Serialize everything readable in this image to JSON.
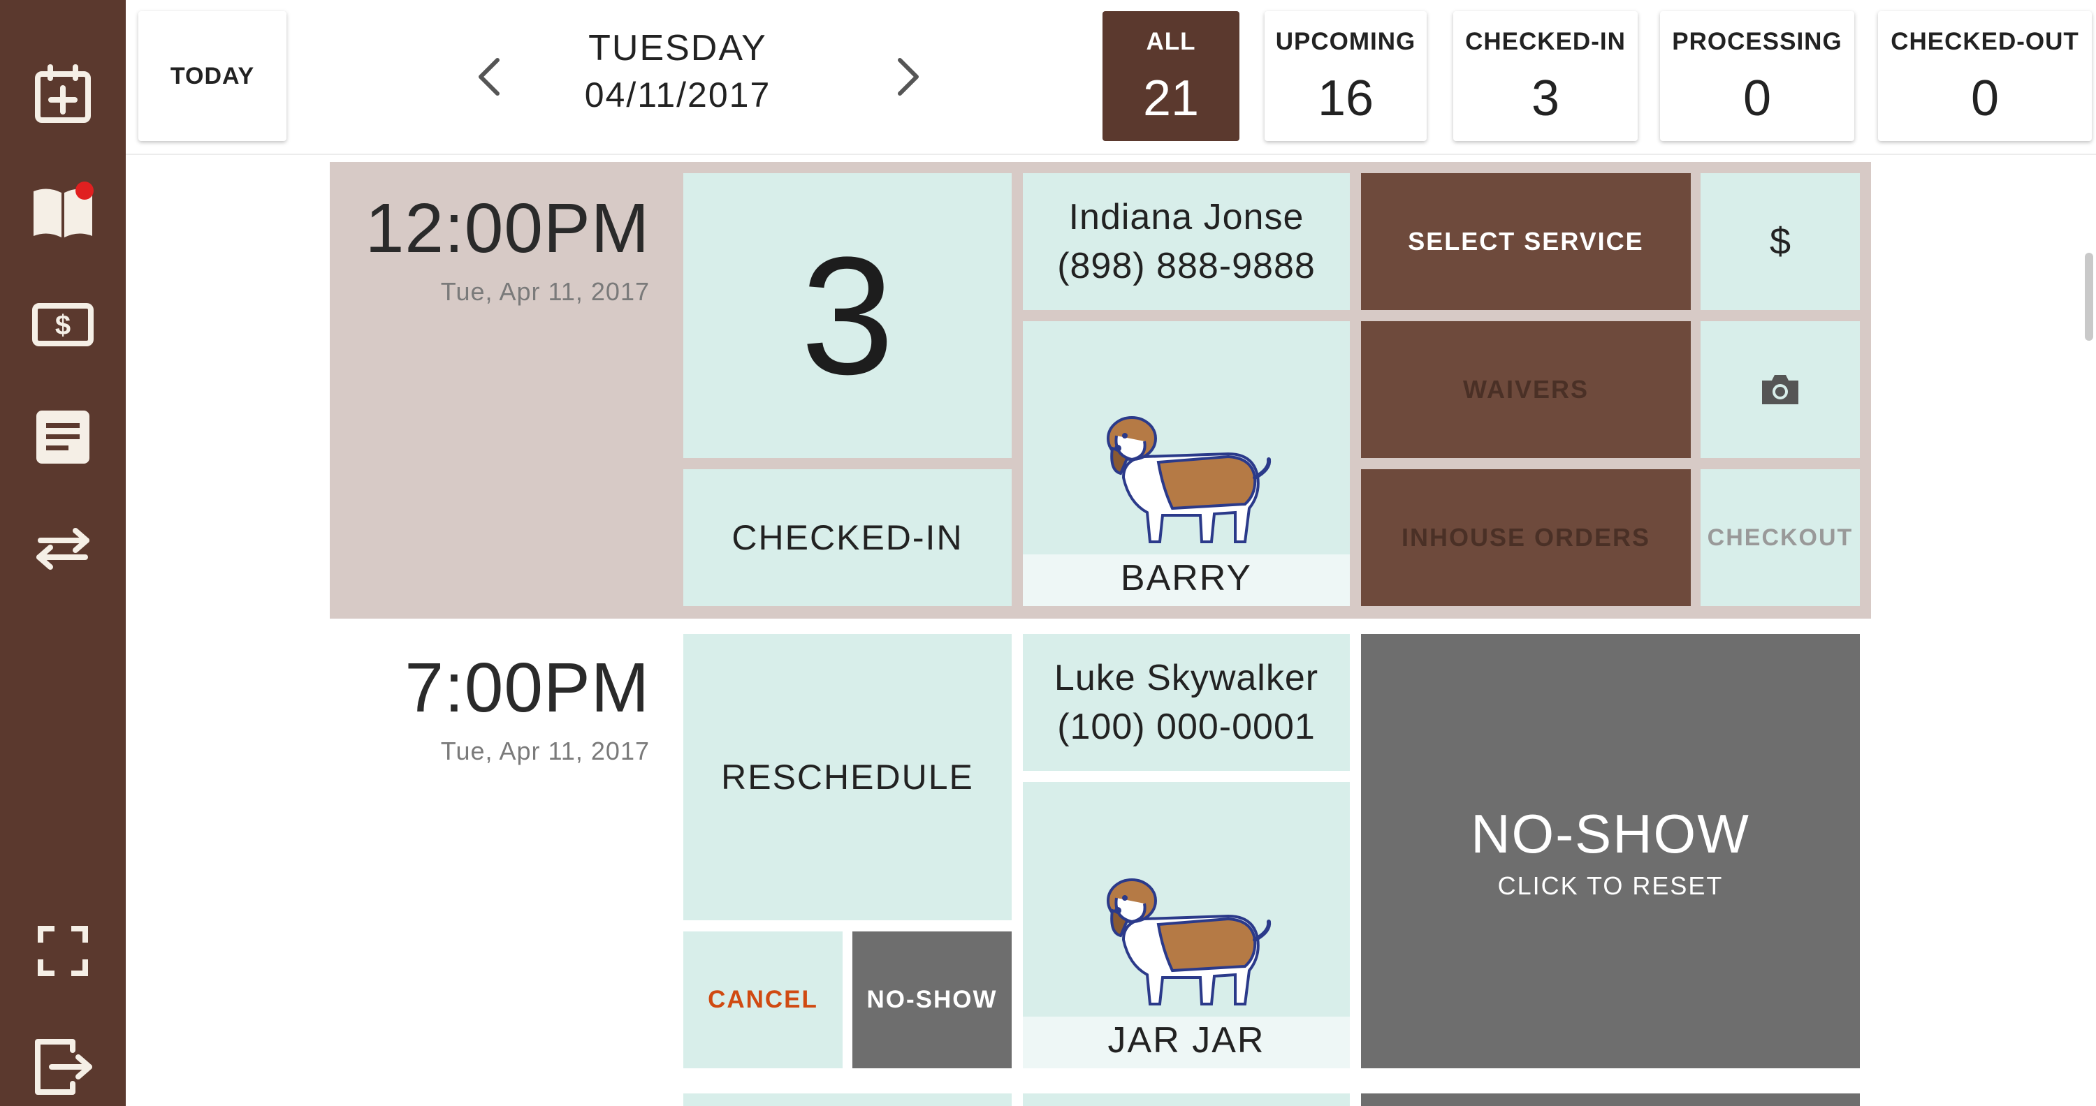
{
  "sidebar": {
    "items": [
      {
        "icon": "calendar-add-icon"
      },
      {
        "icon": "book-icon",
        "notification": true
      },
      {
        "icon": "dollar-bill-icon"
      },
      {
        "icon": "document-icon"
      },
      {
        "icon": "swap-arrows-icon"
      },
      {
        "icon": "fullscreen-icon"
      },
      {
        "icon": "logout-icon"
      }
    ]
  },
  "header": {
    "today_label": "TODAY",
    "day": "TUESDAY",
    "date": "04/11/2017",
    "filters": [
      {
        "label": "ALL",
        "count": "21",
        "active": true
      },
      {
        "label": "UPCOMING",
        "count": "16"
      },
      {
        "label": "CHECKED-IN",
        "count": "3"
      },
      {
        "label": "PROCESSING",
        "count": "0"
      },
      {
        "label": "CHECKED-OUT",
        "count": "0"
      }
    ]
  },
  "appointments": [
    {
      "time": "12:00PM",
      "date": "Tue, Apr 11, 2017",
      "number": "3",
      "status": "CHECKED-IN",
      "owner_name": "Indiana Jonse",
      "owner_phone": "(898) 888-9888",
      "pet_name": "BARRY",
      "actions": {
        "select_service": "SELECT SERVICE",
        "waivers": "WAIVERS",
        "inhouse_orders": "INHOUSE ORDERS",
        "price": "$",
        "checkout": "CHECKOUT"
      }
    },
    {
      "time": "7:00PM",
      "date": "Tue, Apr 11, 2017",
      "reschedule": "RESCHEDULE",
      "cancel": "CANCEL",
      "no_show": "NO-SHOW",
      "owner_name": "Luke Skywalker",
      "owner_phone": "(100) 000-0001",
      "pet_name": "JAR JAR",
      "no_show_title": "NO-SHOW",
      "no_show_sub": "CLICK TO RESET"
    }
  ],
  "colors": {
    "sidebar": "#5b392e",
    "tile": "#d8eeea",
    "brown_button": "#6e4a3c",
    "no_show": "#6e6e6e",
    "row_highlight": "#d7cac6",
    "cancel": "#d04a12"
  }
}
